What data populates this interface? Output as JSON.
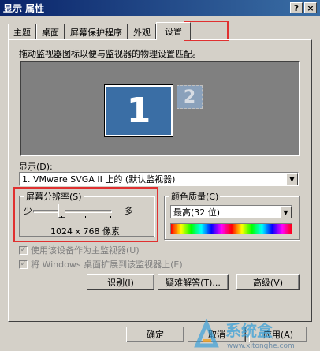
{
  "window": {
    "title": "显示 属性",
    "help_label": "?",
    "close_label": "×"
  },
  "tabs": [
    "主题",
    "桌面",
    "屏幕保护程序",
    "外观",
    "设置"
  ],
  "settings": {
    "description": "拖动监视器图标以便与监视器的物理设置匹配。",
    "monitors": [
      "1",
      "2"
    ],
    "display_label": "显示(D):",
    "display_value": "1. VMware SVGA II 上的 (默认监视器)",
    "resolution_label": "屏幕分辨率(S)",
    "resolution_less": "少",
    "resolution_more": "多",
    "resolution_value": "1024 x 768 像素",
    "color_label": "颜色质量(C)",
    "color_value": "最高(32 位)",
    "primary_checkbox": "使用该设备作为主监视器(U)",
    "extend_checkbox": "将 Windows 桌面扩展到该监视器上(E)",
    "identify_button": "识别(I)",
    "troubleshoot_button": "疑难解答(T)...",
    "advanced_button": "高级(V)"
  },
  "footer": {
    "ok_button": "确定",
    "cancel_button": "取消",
    "apply_button": "应用(A)"
  },
  "watermark": {
    "text": "系统盒",
    "url": "www.xitonghe.com"
  },
  "colors": {
    "titlebar": "#0a246a",
    "highlight": "#e03030",
    "monitor_selected": "#3a6ea5",
    "desktop": "#808080"
  }
}
